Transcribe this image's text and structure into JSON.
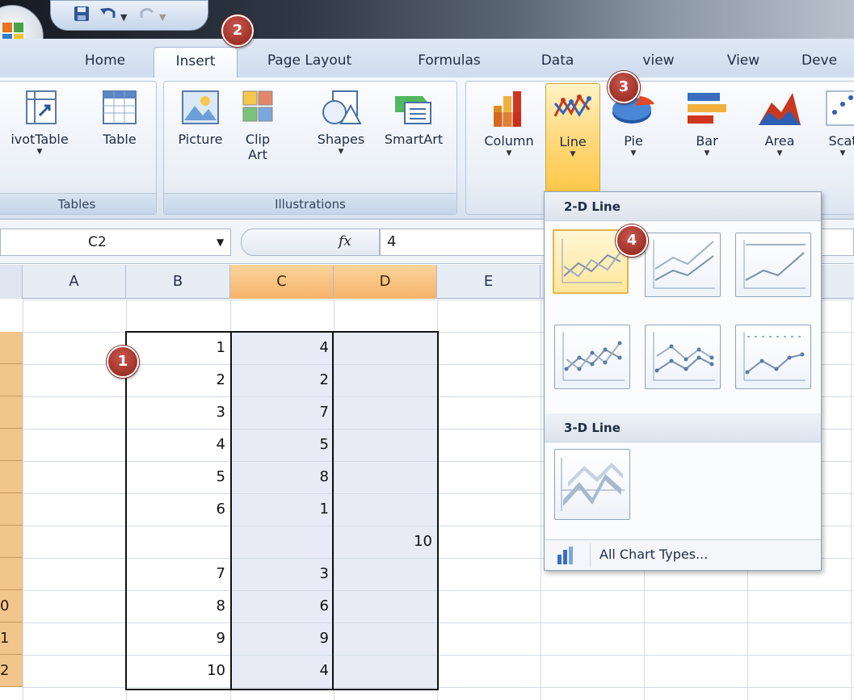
{
  "quick_access": {
    "save_icon": "save-icon",
    "undo_icon": "undo-icon",
    "redo_icon": "redo-icon"
  },
  "tabs": [
    {
      "label": "Home"
    },
    {
      "label": "Insert",
      "active": true
    },
    {
      "label": "Page Layout"
    },
    {
      "label": "Formulas"
    },
    {
      "label": "Data"
    },
    {
      "label": "view"
    },
    {
      "label": "View"
    },
    {
      "label": "Deve"
    }
  ],
  "ribbon": {
    "groups": {
      "tables": {
        "label": "Tables",
        "buttons": [
          {
            "label": "ivotTable",
            "icon": "pivottable-icon"
          },
          {
            "label": "Table",
            "icon": "table-icon"
          }
        ]
      },
      "illustrations": {
        "label": "Illustrations",
        "buttons": [
          {
            "label": "Picture",
            "icon": "picture-icon"
          },
          {
            "label": "Clip",
            "label2": "Art",
            "icon": "clipart-icon"
          },
          {
            "label": "Shapes",
            "icon": "shapes-icon"
          },
          {
            "label": "SmartArt",
            "icon": "smartart-icon"
          }
        ]
      },
      "charts": {
        "buttons": [
          {
            "label": "Column",
            "icon": "column-chart-icon"
          },
          {
            "label": "Line",
            "icon": "line-chart-icon",
            "selected": true
          },
          {
            "label": "Pie",
            "icon": "pie-chart-icon"
          },
          {
            "label": "Bar",
            "icon": "bar-chart-icon"
          },
          {
            "label": "Area",
            "icon": "area-chart-icon"
          },
          {
            "label": "Scat",
            "icon": "scatter-chart-icon"
          }
        ]
      }
    }
  },
  "formula_bar": {
    "name_box": "C2",
    "fx_label": "fx",
    "value": "4"
  },
  "columns": [
    "A",
    "B",
    "C",
    "D",
    "E"
  ],
  "rows": {
    "partial_labels": [
      "0",
      "1",
      "2"
    ]
  },
  "cells": [
    {
      "b": "1",
      "c": "4",
      "d": ""
    },
    {
      "b": "2",
      "c": "2",
      "d": ""
    },
    {
      "b": "3",
      "c": "7",
      "d": ""
    },
    {
      "b": "4",
      "c": "5",
      "d": ""
    },
    {
      "b": "5",
      "c": "8",
      "d": ""
    },
    {
      "b": "6",
      "c": "1",
      "d": ""
    },
    {
      "b": "",
      "c": "",
      "d": "10"
    },
    {
      "b": "7",
      "c": "3",
      "d": ""
    },
    {
      "b": "8",
      "c": "6",
      "d": ""
    },
    {
      "b": "9",
      "c": "9",
      "d": ""
    },
    {
      "b": "10",
      "c": "4",
      "d": ""
    }
  ],
  "callouts": [
    "1",
    "2",
    "3",
    "4"
  ],
  "dropdown": {
    "section_2d": "2-D Line",
    "section_3d": "3-D Line",
    "footer": "All Chart Types...",
    "thumbs_2d": [
      "line",
      "stacked-line",
      "100-stacked-line",
      "line-markers",
      "stacked-line-markers",
      "100-stacked-line-markers"
    ],
    "thumbs_3d": [
      "3d-line"
    ]
  },
  "colors": {
    "selection": "#e8ebf6",
    "row_header": "#f2c58c",
    "callout": "#a03127",
    "active_column": "#f5b26a"
  }
}
